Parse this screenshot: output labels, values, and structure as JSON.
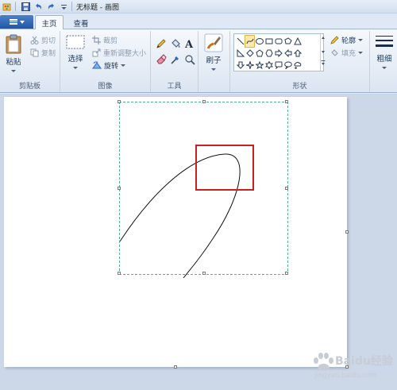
{
  "titlebar": {
    "title": "无标题 - 画图",
    "quick_access": [
      "paint-app-icon",
      "save-icon",
      "undo-icon",
      "redo-icon",
      "customize-icon"
    ]
  },
  "tabs": {
    "file_label": "",
    "home": "主页",
    "view": "查看"
  },
  "ribbon": {
    "clipboard": {
      "group_label": "剪贴板",
      "paste": "粘贴",
      "cut": "剪切",
      "copy": "复制"
    },
    "image": {
      "group_label": "图像",
      "select": "选择",
      "crop": "裁剪",
      "resize": "重新调整大小",
      "rotate": "旋转"
    },
    "tools": {
      "group_label": "工具"
    },
    "brushes": {
      "label": "刷子"
    },
    "shapes": {
      "group_label": "形状",
      "outline": "轮廓",
      "fill": "填充",
      "selected_shape": "curve"
    },
    "size": {
      "label": "粗细"
    }
  },
  "canvas": {
    "highlight_color": "#cc1e1e",
    "selection_color": "#4fb39a"
  },
  "watermark": {
    "text": "Baidu经验",
    "url": "jingyan.baidu.com"
  }
}
